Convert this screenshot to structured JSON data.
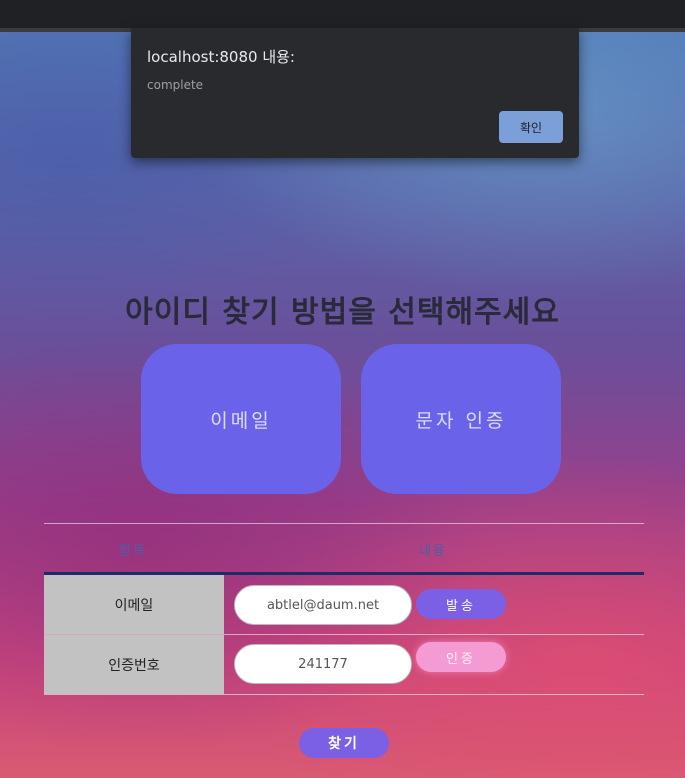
{
  "dialog": {
    "title": "localhost:8080 내용:",
    "message": "complete",
    "ok_label": "확인"
  },
  "page": {
    "heading": "아이디 찾기 방법을 선택해주세요"
  },
  "methods": {
    "email_label": "이메일",
    "sms_label": "문자 인증"
  },
  "table": {
    "header_item": "항목",
    "header_content": "내용",
    "email_label": "이메일",
    "email_value": "abtlel@daum.net",
    "send_label": "발송",
    "code_label": "인증번호",
    "code_value": "241177",
    "verify_label": "인증"
  },
  "find_label": "찾기",
  "colors": {
    "accent": "#7b60e6",
    "method_button": "#6a63ea",
    "verify_button": "#f39bd2",
    "dialog_bg": "#292a2d"
  }
}
